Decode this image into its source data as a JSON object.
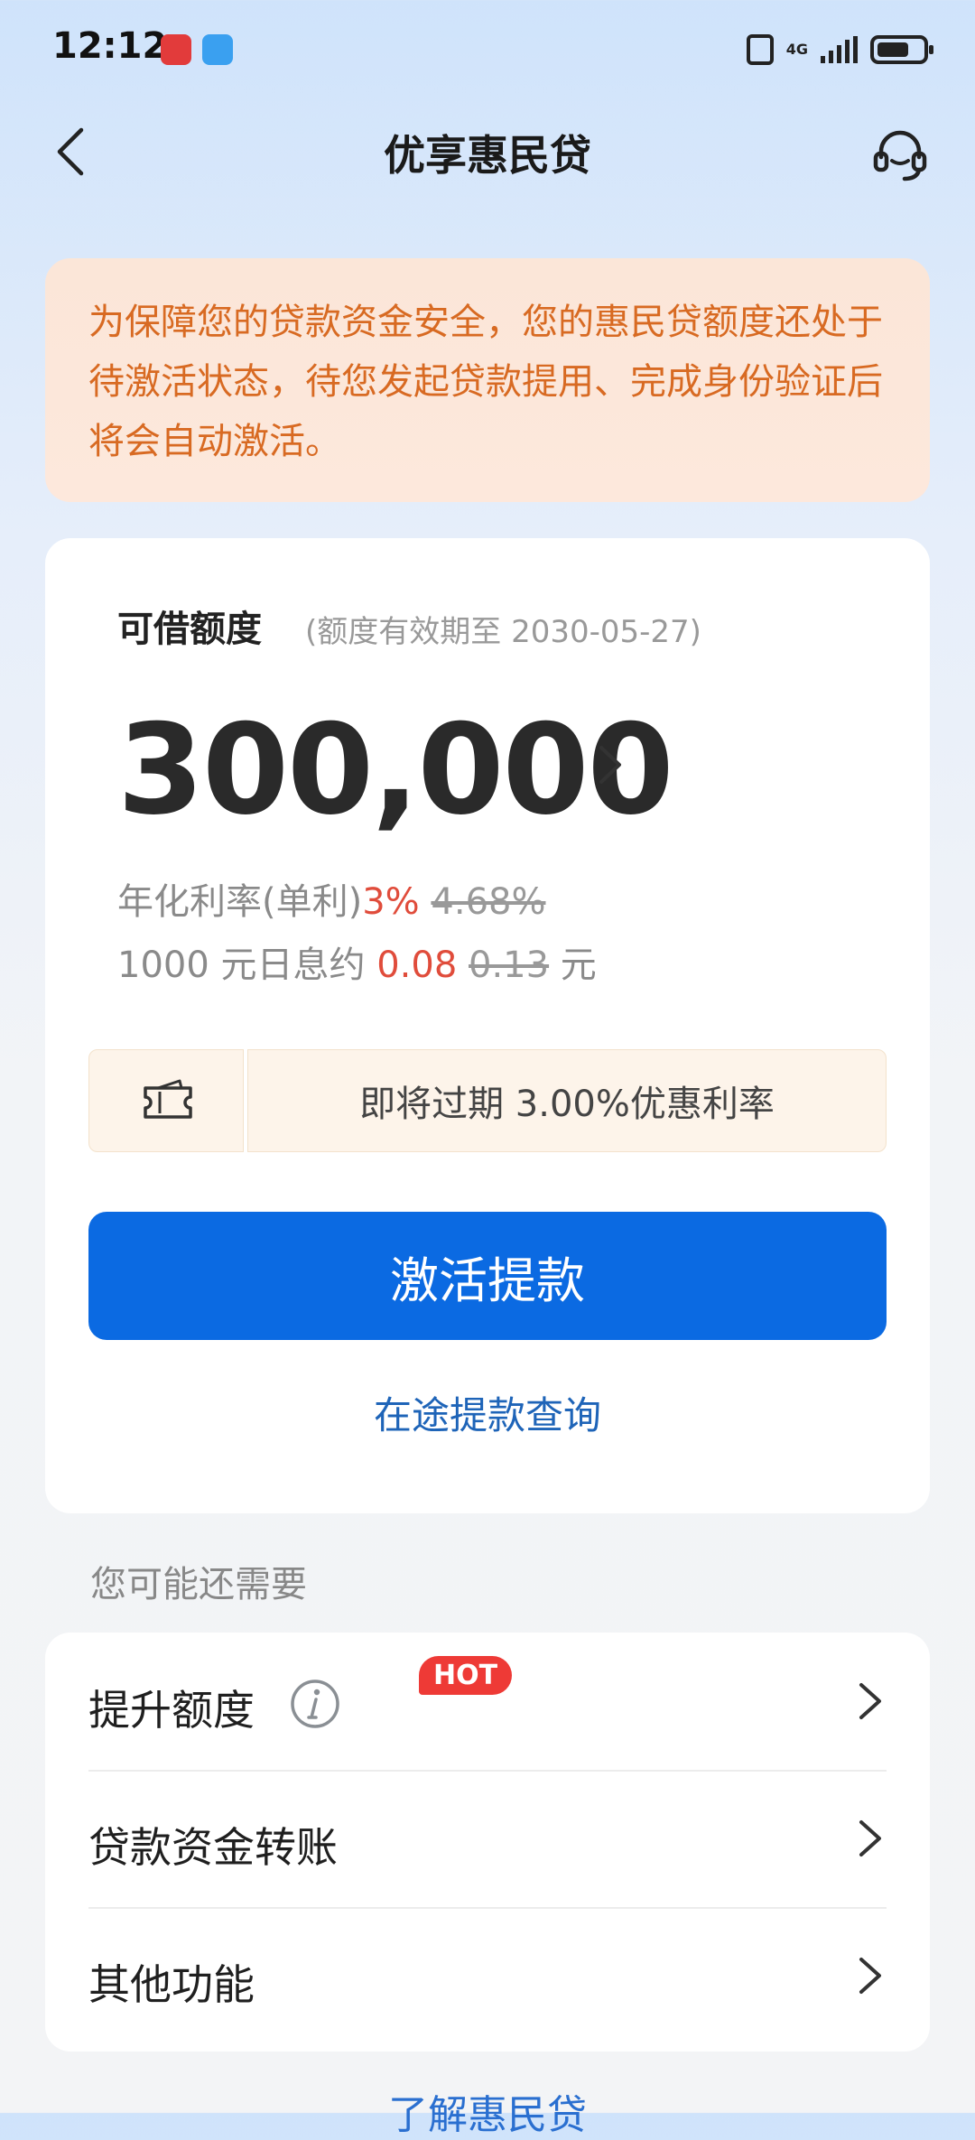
{
  "status_bar": {
    "time": "12:12",
    "network": "4G"
  },
  "header": {
    "title": "优享惠民贷"
  },
  "notice": {
    "text": "为保障您的贷款资金安全，您的惠民贷额度还处于待激活状态，待您发起贷款提用、完成身份验证后将会自动激活。"
  },
  "credit": {
    "label": "可借额度",
    "validity": "(额度有效期至 2030-05-27)",
    "amount": "300,000",
    "rate_label": "年化利率(单利)",
    "rate_value": "3%",
    "rate_old": "4.68%",
    "interest_prefix": "1000 元日息约 ",
    "interest_value": "0.08",
    "interest_old": "0.13",
    "interest_suffix": " 元"
  },
  "coupon": {
    "text": "即将过期 3.00%优惠利率"
  },
  "actions": {
    "activate_label": "激活提款",
    "query_label": "在途提款查询"
  },
  "section": {
    "label": "您可能还需要"
  },
  "menu": [
    {
      "label": "提升额度",
      "badge": "HOT"
    },
    {
      "label": "贷款资金转账"
    },
    {
      "label": "其他功能"
    }
  ],
  "footer": {
    "text": "了解惠民贷"
  },
  "colors": {
    "primary": "#0b6ae2",
    "accent_red": "#e04c3b",
    "notice_text": "#d86a22",
    "link_blue": "#1e64b8"
  }
}
